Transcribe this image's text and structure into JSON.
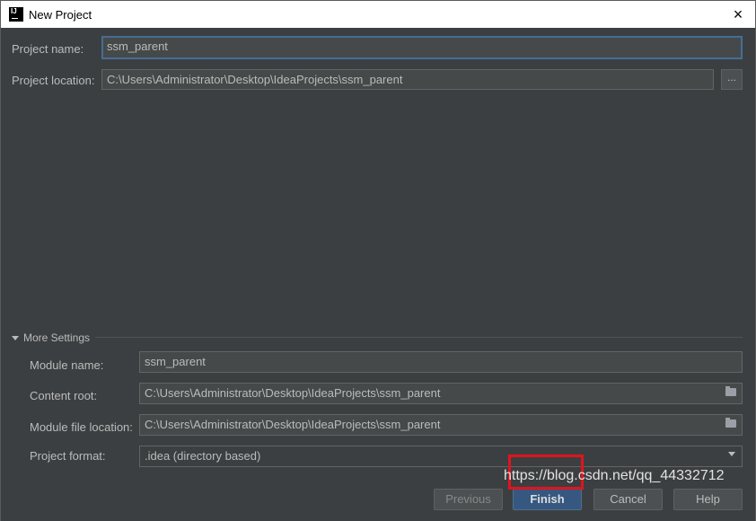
{
  "window": {
    "title": "New Project",
    "app_icon": "intellij-icon",
    "close_symbol": "×"
  },
  "project_name": {
    "label": "Project name:",
    "value": "ssm_parent"
  },
  "project_location": {
    "label": "Project location:",
    "value": "C:\\Users\\Administrator\\Desktop\\IdeaProjects\\ssm_parent",
    "browse_label": "..."
  },
  "more_settings": {
    "label": "More Settings",
    "module_name": {
      "label": "Module name:",
      "value": "ssm_parent"
    },
    "content_root": {
      "label": "Content root:",
      "value": "C:\\Users\\Administrator\\Desktop\\IdeaProjects\\ssm_parent"
    },
    "module_file_location": {
      "label": "Module file location:",
      "value": "C:\\Users\\Administrator\\Desktop\\IdeaProjects\\ssm_parent"
    },
    "project_format": {
      "label": "Project format:",
      "value": ".idea (directory based)"
    }
  },
  "buttons": {
    "previous": "Previous",
    "finish": "Finish",
    "cancel": "Cancel",
    "help": "Help"
  },
  "watermark": "https://blog.csdn.net/qq_44332712",
  "colors": {
    "background": "#3c3f41",
    "field": "#45494a",
    "focus_border": "#466d94",
    "primary_button": "#365880",
    "highlight": "#e0141e"
  }
}
